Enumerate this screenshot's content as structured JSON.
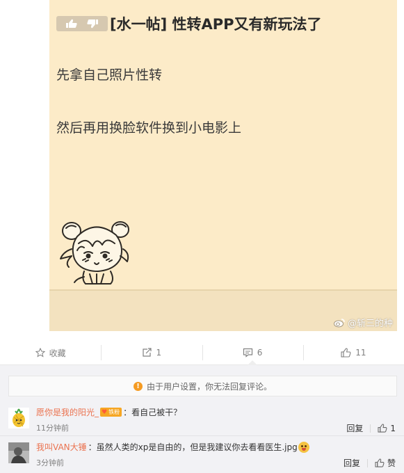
{
  "post": {
    "title": "[水一帖] 性转APP又有新玩法了",
    "lines": [
      "先拿自己照片性转",
      "然后再用换脸软件换到小电影上"
    ],
    "watermark": "@斩三的种"
  },
  "actions": {
    "favorite_label": "收藏",
    "repost_count": "1",
    "comment_count": "6",
    "like_count": "11"
  },
  "comments": {
    "notice": "由于用户设置，你无法回复评论。",
    "items": [
      {
        "user": "愿你是我的阳光_",
        "badge": "铁粉",
        "text": "：看自己被干？",
        "time": "11分钟前",
        "reply_label": "回复",
        "like_label": "1"
      },
      {
        "user": "我叫VAN大锤",
        "text": "：虽然人类的xp是自由的，但是我建议你去看看医生.jpg",
        "time": "3分钟前",
        "reply_label": "回复",
        "like_label": "赞"
      }
    ]
  },
  "colors": {
    "post_background": "#fcebc8",
    "username": "#eb7350",
    "notice_icon": "#f59b22"
  }
}
